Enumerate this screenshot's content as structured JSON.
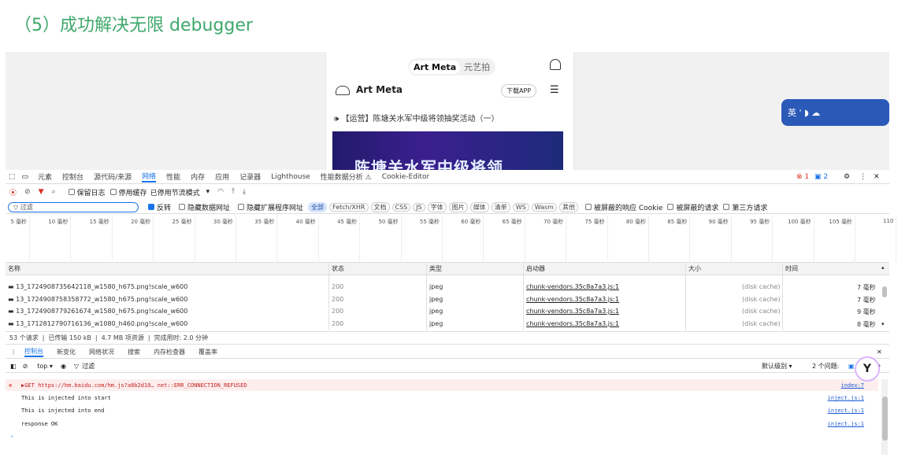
{
  "heading": "（5）成功解决无限 debugger",
  "viewport": {
    "segment": [
      "Art Meta",
      "元艺拍"
    ],
    "brand": "Art Meta",
    "download_app": "下载APP",
    "menu_icon": "hamburger-icon",
    "notice": "🕪 【运营】陈塘关水军中级将领抽奖活动（一）",
    "banner_text": "陈塘关水军中级将领",
    "translate_widget": "英 ' ◗ ☁",
    "colors": {
      "banner": "#221a6b",
      "widget": "#2a59b8"
    }
  },
  "devtools": {
    "tabs": [
      "元素",
      "控制台",
      "源代码/来源",
      "网络",
      "性能",
      "内存",
      "应用",
      "记录器",
      "Lighthouse",
      "性能数据分析 ⚠",
      "Cookie-Editor"
    ],
    "active_tab": "网络",
    "errors": "1",
    "messages": "2",
    "toolbar": {
      "preserve_log": "保留日志",
      "disable_cache": "停用缓存",
      "throttling": "已停用节流模式"
    },
    "filter": {
      "placeholder": "过滤",
      "invert": "反转",
      "hide_data_urls": "隐藏数据网址",
      "hide_ext_urls": "隐藏扩展程序网址",
      "chips": [
        "全部",
        "Fetch/XHR",
        "文档",
        "CSS",
        "JS",
        "字体",
        "图片",
        "媒体",
        "清单",
        "WS",
        "Wasm",
        "其他"
      ],
      "blocked_cookies": "被屏蔽的响应 Cookie",
      "blocked_requests": "被屏蔽的请求",
      "third_party": "第三方请求"
    },
    "timeline_ticks": [
      "5 毫秒",
      "10 毫秒",
      "15 毫秒",
      "20 毫秒",
      "25 毫秒",
      "30 毫秒",
      "35 毫秒",
      "40 毫秒",
      "45 毫秒",
      "50 毫秒",
      "55 毫秒",
      "60 毫秒",
      "65 毫秒",
      "70 毫秒",
      "75 毫秒",
      "80 毫秒",
      "85 毫秒",
      "90 毫秒",
      "95 毫秒",
      "100 毫秒",
      "105 毫秒",
      "110"
    ],
    "columns": [
      "名称",
      "状态",
      "类型",
      "启动器",
      "大小",
      "时间"
    ],
    "rows": [
      {
        "name": "13_1724908735642118_w1580_h675.png!scale_w600",
        "status": "200",
        "type": "jpeg",
        "initiator": "chunk-vendors.35c8a7a3.js:1",
        "size": "(disk cache)",
        "time": "7 毫秒"
      },
      {
        "name": "13_1724908758358772_w1580_h675.png!scale_w600",
        "status": "200",
        "type": "jpeg",
        "initiator": "chunk-vendors.35c8a7a3.js:1",
        "size": "(disk cache)",
        "time": "7 毫秒"
      },
      {
        "name": "13_1724908779261674_w1580_h675.png!scale_w600",
        "status": "200",
        "type": "jpeg",
        "initiator": "chunk-vendors.35c8a7a3.js:1",
        "size": "(disk cache)",
        "time": "9 毫秒"
      },
      {
        "name": "13_1712812790716136_w1080_h460.png!scale_w600",
        "status": "200",
        "type": "jpeg",
        "initiator": "chunk-vendors.35c8a7a3.js:1",
        "size": "(disk cache)",
        "time": "8 毫秒"
      }
    ],
    "summary": [
      "53 个请求",
      "已传输 150 kB",
      "4.7 MB 项资源",
      "完成用时: 2.0 分钟"
    ],
    "drawer_tabs": [
      "控制台",
      "新变化",
      "网络状况",
      "搜索",
      "内存检查器",
      "覆盖率"
    ],
    "drawer_active": "控制台",
    "console": {
      "context": "top ▾",
      "filter_placeholder": "过滤",
      "levels": "默认级别 ▾",
      "issues_label": "2 个问题:",
      "issues_count": "2",
      "lines": [
        {
          "text": "▶GET https://hm.baidu.com/hm.js?a8b2d10… net::ERR_CONNECTION_REFUSED",
          "source": "index:7",
          "level": "error"
        },
        {
          "text": "This is injected into start",
          "source": "inject.js:1",
          "level": "log"
        },
        {
          "text": "This is injected into end",
          "source": "inject.js:1",
          "level": "log"
        },
        {
          "text": "response OK",
          "source": "inject.js:1",
          "level": "log"
        }
      ],
      "prompt": "›"
    }
  }
}
